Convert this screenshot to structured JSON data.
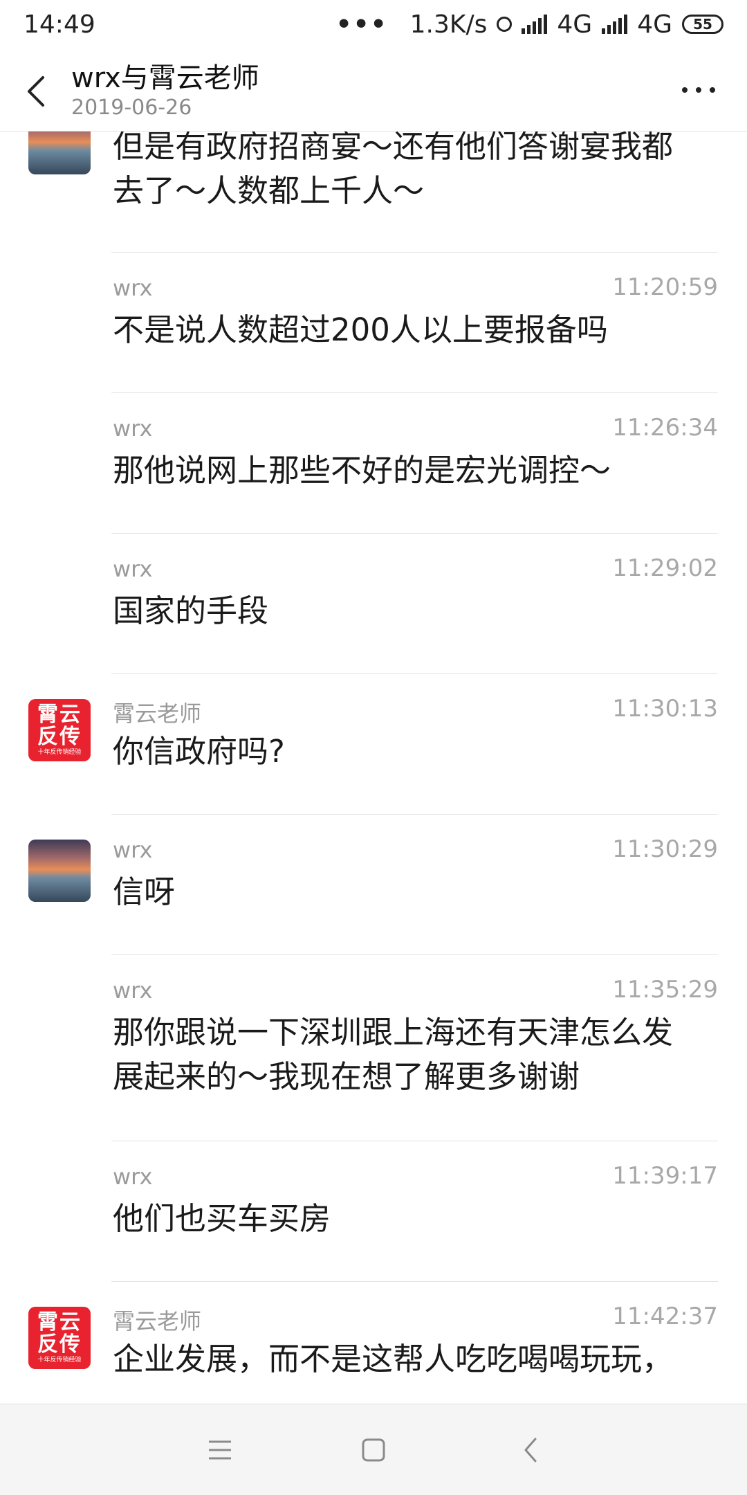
{
  "status_bar": {
    "time": "14:49",
    "more": "•••",
    "speed": "1.3K/s",
    "net1": "4G",
    "net2": "4G",
    "battery": "55"
  },
  "header": {
    "title": "wrx与霄云老师",
    "date": "2019-06-26"
  },
  "messages": [
    {
      "sender": "",
      "time": "",
      "text": "但是有政府招商宴～还有他们答谢宴我都去了～人数都上千人～",
      "avatar": "photo"
    },
    {
      "sender": "wrx",
      "time": "11:20:59",
      "text": "不是说人数超过200人以上要报备吗",
      "avatar": ""
    },
    {
      "sender": "wrx",
      "time": "11:26:34",
      "text": "那他说网上那些不好的是宏光调控～",
      "avatar": ""
    },
    {
      "sender": "wrx",
      "time": "11:29:02",
      "text": "国家的手段",
      "avatar": ""
    },
    {
      "sender": "霄云老师",
      "time": "11:30:13",
      "text": "你信政府吗?",
      "avatar": "logo"
    },
    {
      "sender": "wrx",
      "time": "11:30:29",
      "text": "信呀",
      "avatar": "photo"
    },
    {
      "sender": "wrx",
      "time": "11:35:29",
      "text": "那你跟说一下深圳跟上海还有天津怎么发展起来的～我现在想了解更多谢谢",
      "avatar": ""
    },
    {
      "sender": "wrx",
      "time": "11:39:17",
      "text": "他们也买车买房",
      "avatar": ""
    },
    {
      "sender": "霄云老师",
      "time": "11:42:37",
      "text": "企业发展，而不是这帮人吃吃喝喝玩玩，",
      "avatar": "logo"
    }
  ],
  "logo_avatar": {
    "line1": "霄云",
    "line2": "反传",
    "line3": "十年反传销经验"
  },
  "colors": {
    "logo_red": "#e8232f",
    "separator": "#e4e4e4",
    "meta_gray": "#a8a8a8"
  },
  "icons": {
    "back": "chevron-left-icon",
    "more": "more-dots-icon",
    "nav_menu": "menu-icon",
    "nav_home": "home-square-icon",
    "nav_back": "nav-back-icon"
  }
}
